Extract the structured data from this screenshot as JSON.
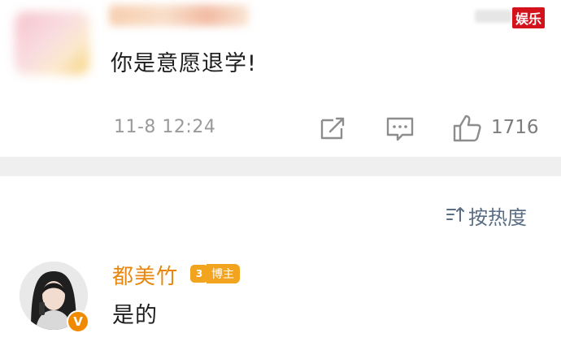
{
  "watermark": {
    "label": "娱乐"
  },
  "top_comment": {
    "text": "你是意愿退学!",
    "time": "11-8 12:24",
    "actions": {
      "forward_icon": "share-icon",
      "reply_icon": "comment-icon",
      "like_icon": "thumb-up-icon",
      "like_count": "1716"
    }
  },
  "sort": {
    "icon": "sort-icon",
    "label": "按热度"
  },
  "reply": {
    "user_name": "都美竹",
    "badge_level": "3",
    "badge_label": "博主",
    "verified_icon": "V",
    "text": "是的"
  },
  "colors": {
    "name_orange": "#e8870f",
    "badge_orange": "#f3a41e",
    "divider_gray": "#efefef",
    "watermark_red": "#d3121c"
  }
}
